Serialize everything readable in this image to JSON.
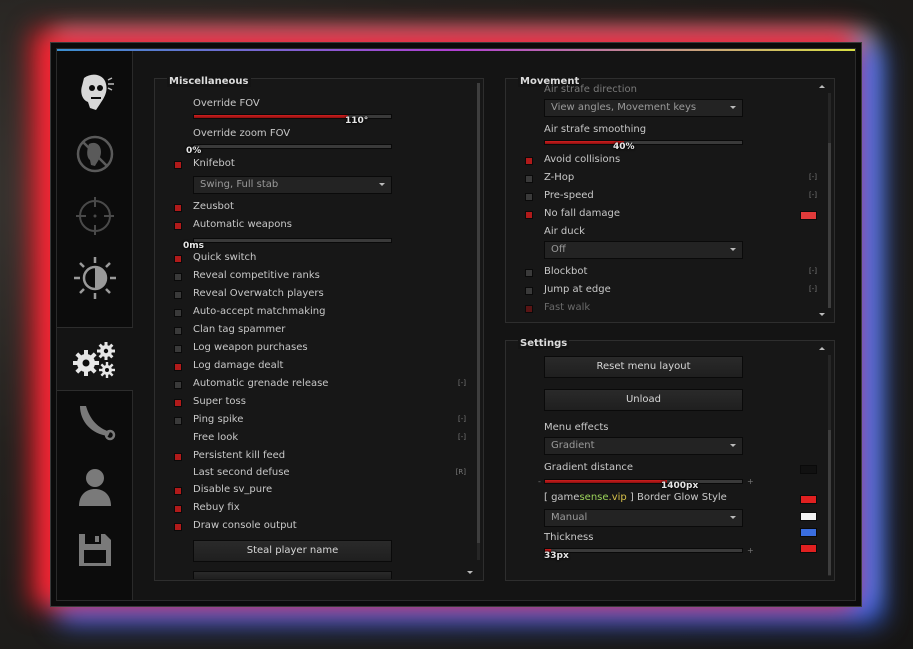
{
  "colors": {
    "accent": "#b01a1a",
    "glow_left": "#ff1e28",
    "glow_right": "#3c6eff",
    "topbar": [
      "#3b8fd0",
      "#b13fd2",
      "#d8e043"
    ]
  },
  "sidebar": {
    "tabs": [
      {
        "icon": "ragebot-icon",
        "active": false
      },
      {
        "icon": "anti-aim-icon",
        "active": false
      },
      {
        "icon": "crosshair-icon",
        "active": false
      },
      {
        "icon": "visuals-icon",
        "active": false
      },
      {
        "icon": "gears-icon",
        "active": true
      },
      {
        "icon": "knife-icon",
        "active": false
      },
      {
        "icon": "player-icon",
        "active": false
      },
      {
        "icon": "save-icon",
        "active": false
      }
    ]
  },
  "misc": {
    "title": "Miscellaneous",
    "override_fov": {
      "label": "Override FOV",
      "value": "110°",
      "fraction": 0.78
    },
    "override_zoom_fov": {
      "label": "Override zoom FOV",
      "value": "0%",
      "fraction": 0
    },
    "knifebot": {
      "label": "Knifebot",
      "checked": true
    },
    "knifebot_mode": "Swing, Full stab",
    "zeusbot": {
      "label": "Zeusbot",
      "checked": true
    },
    "automatic_weapons": {
      "label": "Automatic weapons",
      "checked": true
    },
    "auto_weapons_delay": {
      "value": "0ms",
      "fraction": 0
    },
    "items": [
      {
        "label": "Quick switch",
        "checked": true,
        "key": ""
      },
      {
        "label": "Reveal competitive ranks",
        "checked": false,
        "key": ""
      },
      {
        "label": "Reveal Overwatch players",
        "checked": false,
        "key": ""
      },
      {
        "label": "Auto-accept matchmaking",
        "checked": false,
        "key": ""
      },
      {
        "label": "Clan tag spammer",
        "checked": false,
        "key": ""
      },
      {
        "label": "Log weapon purchases",
        "checked": false,
        "key": ""
      },
      {
        "label": "Log damage dealt",
        "checked": true,
        "key": ""
      },
      {
        "label": "Automatic grenade release",
        "checked": false,
        "key": "[-]"
      },
      {
        "label": "Super toss",
        "checked": true,
        "key": ""
      },
      {
        "label": "Ping spike",
        "checked": false,
        "key": "[-]"
      }
    ],
    "free_look": {
      "label": "Free look",
      "key": "[-]"
    },
    "persistent_kill_feed": {
      "label": "Persistent kill feed",
      "checked": true
    },
    "last_second_defuse": {
      "label": "Last second defuse",
      "key": "[R]"
    },
    "items2": [
      {
        "label": "Disable sv_pure",
        "checked": true
      },
      {
        "label": "Rebuy fix",
        "checked": true
      },
      {
        "label": "Draw console output",
        "checked": true
      }
    ],
    "steal_player_name": "Steal player name"
  },
  "movement": {
    "title": "Movement",
    "air_strafe_direction_label": "Air strafe direction",
    "air_strafe_direction_value": "View angles, Movement keys",
    "air_strafe_smoothing": {
      "label": "Air strafe smoothing",
      "value": "40%",
      "fraction": 0.4
    },
    "avoid_collisions": {
      "label": "Avoid collisions",
      "checked": true
    },
    "z_hop": {
      "label": "Z-Hop",
      "checked": false,
      "key": "[-]"
    },
    "pre_speed": {
      "label": "Pre-speed",
      "checked": false,
      "key": "[-]"
    },
    "no_fall_damage": {
      "label": "No fall damage",
      "checked": true,
      "color": "#e03a3a"
    },
    "air_duck_label": "Air duck",
    "air_duck_value": "Off",
    "blockbot": {
      "label": "Blockbot",
      "checked": false,
      "key": "[-]"
    },
    "jump_at_edge": {
      "label": "Jump at edge",
      "checked": false,
      "key": "[-]"
    },
    "fast_walk": {
      "label": "Fast walk",
      "checked": true
    }
  },
  "settings": {
    "title": "Settings",
    "reset_menu_layout": "Reset menu layout",
    "unload": "Unload",
    "menu_effects_label": "Menu effects",
    "menu_effects_value": "Gradient",
    "gradient_distance": {
      "label": "Gradient distance",
      "value": "1400px",
      "fraction": 0.62
    },
    "border_glow": {
      "prefix": "[ game",
      "sense": "sense",
      "vip": ".vip",
      "suffix": " ] Border Glow Style"
    },
    "border_glow_value": "Manual",
    "thickness": {
      "label": "Thickness",
      "value": "33px",
      "fraction": 0.03
    },
    "swatches": {
      "gradient": "#111111",
      "glow1": "#e02020",
      "glow2": "#f2f2f2",
      "glow3": "#3a6ee0",
      "glow4": "#e02020"
    }
  }
}
